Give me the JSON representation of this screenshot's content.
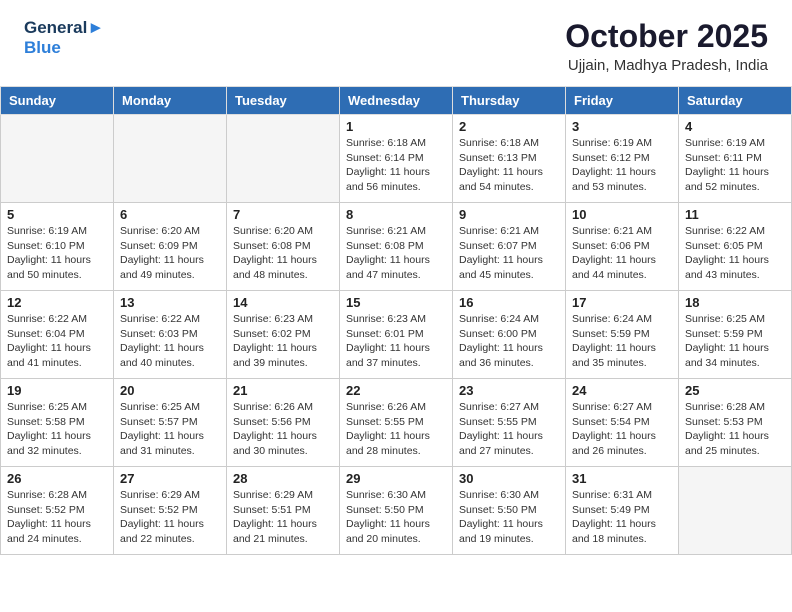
{
  "header": {
    "logo_line1": "General",
    "logo_line2": "Blue",
    "month": "October 2025",
    "location": "Ujjain, Madhya Pradesh, India"
  },
  "days_of_week": [
    "Sunday",
    "Monday",
    "Tuesday",
    "Wednesday",
    "Thursday",
    "Friday",
    "Saturday"
  ],
  "weeks": [
    [
      {
        "day": "",
        "info": "",
        "empty": true
      },
      {
        "day": "",
        "info": "",
        "empty": true
      },
      {
        "day": "",
        "info": "",
        "empty": true
      },
      {
        "day": "1",
        "info": "Sunrise: 6:18 AM\nSunset: 6:14 PM\nDaylight: 11 hours\nand 56 minutes."
      },
      {
        "day": "2",
        "info": "Sunrise: 6:18 AM\nSunset: 6:13 PM\nDaylight: 11 hours\nand 54 minutes."
      },
      {
        "day": "3",
        "info": "Sunrise: 6:19 AM\nSunset: 6:12 PM\nDaylight: 11 hours\nand 53 minutes."
      },
      {
        "day": "4",
        "info": "Sunrise: 6:19 AM\nSunset: 6:11 PM\nDaylight: 11 hours\nand 52 minutes."
      }
    ],
    [
      {
        "day": "5",
        "info": "Sunrise: 6:19 AM\nSunset: 6:10 PM\nDaylight: 11 hours\nand 50 minutes."
      },
      {
        "day": "6",
        "info": "Sunrise: 6:20 AM\nSunset: 6:09 PM\nDaylight: 11 hours\nand 49 minutes."
      },
      {
        "day": "7",
        "info": "Sunrise: 6:20 AM\nSunset: 6:08 PM\nDaylight: 11 hours\nand 48 minutes."
      },
      {
        "day": "8",
        "info": "Sunrise: 6:21 AM\nSunset: 6:08 PM\nDaylight: 11 hours\nand 47 minutes."
      },
      {
        "day": "9",
        "info": "Sunrise: 6:21 AM\nSunset: 6:07 PM\nDaylight: 11 hours\nand 45 minutes."
      },
      {
        "day": "10",
        "info": "Sunrise: 6:21 AM\nSunset: 6:06 PM\nDaylight: 11 hours\nand 44 minutes."
      },
      {
        "day": "11",
        "info": "Sunrise: 6:22 AM\nSunset: 6:05 PM\nDaylight: 11 hours\nand 43 minutes."
      }
    ],
    [
      {
        "day": "12",
        "info": "Sunrise: 6:22 AM\nSunset: 6:04 PM\nDaylight: 11 hours\nand 41 minutes."
      },
      {
        "day": "13",
        "info": "Sunrise: 6:22 AM\nSunset: 6:03 PM\nDaylight: 11 hours\nand 40 minutes."
      },
      {
        "day": "14",
        "info": "Sunrise: 6:23 AM\nSunset: 6:02 PM\nDaylight: 11 hours\nand 39 minutes."
      },
      {
        "day": "15",
        "info": "Sunrise: 6:23 AM\nSunset: 6:01 PM\nDaylight: 11 hours\nand 37 minutes."
      },
      {
        "day": "16",
        "info": "Sunrise: 6:24 AM\nSunset: 6:00 PM\nDaylight: 11 hours\nand 36 minutes."
      },
      {
        "day": "17",
        "info": "Sunrise: 6:24 AM\nSunset: 5:59 PM\nDaylight: 11 hours\nand 35 minutes."
      },
      {
        "day": "18",
        "info": "Sunrise: 6:25 AM\nSunset: 5:59 PM\nDaylight: 11 hours\nand 34 minutes."
      }
    ],
    [
      {
        "day": "19",
        "info": "Sunrise: 6:25 AM\nSunset: 5:58 PM\nDaylight: 11 hours\nand 32 minutes."
      },
      {
        "day": "20",
        "info": "Sunrise: 6:25 AM\nSunset: 5:57 PM\nDaylight: 11 hours\nand 31 minutes."
      },
      {
        "day": "21",
        "info": "Sunrise: 6:26 AM\nSunset: 5:56 PM\nDaylight: 11 hours\nand 30 minutes."
      },
      {
        "day": "22",
        "info": "Sunrise: 6:26 AM\nSunset: 5:55 PM\nDaylight: 11 hours\nand 28 minutes."
      },
      {
        "day": "23",
        "info": "Sunrise: 6:27 AM\nSunset: 5:55 PM\nDaylight: 11 hours\nand 27 minutes."
      },
      {
        "day": "24",
        "info": "Sunrise: 6:27 AM\nSunset: 5:54 PM\nDaylight: 11 hours\nand 26 minutes."
      },
      {
        "day": "25",
        "info": "Sunrise: 6:28 AM\nSunset: 5:53 PM\nDaylight: 11 hours\nand 25 minutes."
      }
    ],
    [
      {
        "day": "26",
        "info": "Sunrise: 6:28 AM\nSunset: 5:52 PM\nDaylight: 11 hours\nand 24 minutes."
      },
      {
        "day": "27",
        "info": "Sunrise: 6:29 AM\nSunset: 5:52 PM\nDaylight: 11 hours\nand 22 minutes."
      },
      {
        "day": "28",
        "info": "Sunrise: 6:29 AM\nSunset: 5:51 PM\nDaylight: 11 hours\nand 21 minutes."
      },
      {
        "day": "29",
        "info": "Sunrise: 6:30 AM\nSunset: 5:50 PM\nDaylight: 11 hours\nand 20 minutes."
      },
      {
        "day": "30",
        "info": "Sunrise: 6:30 AM\nSunset: 5:50 PM\nDaylight: 11 hours\nand 19 minutes."
      },
      {
        "day": "31",
        "info": "Sunrise: 6:31 AM\nSunset: 5:49 PM\nDaylight: 11 hours\nand 18 minutes."
      },
      {
        "day": "",
        "info": "",
        "empty": true
      }
    ]
  ]
}
